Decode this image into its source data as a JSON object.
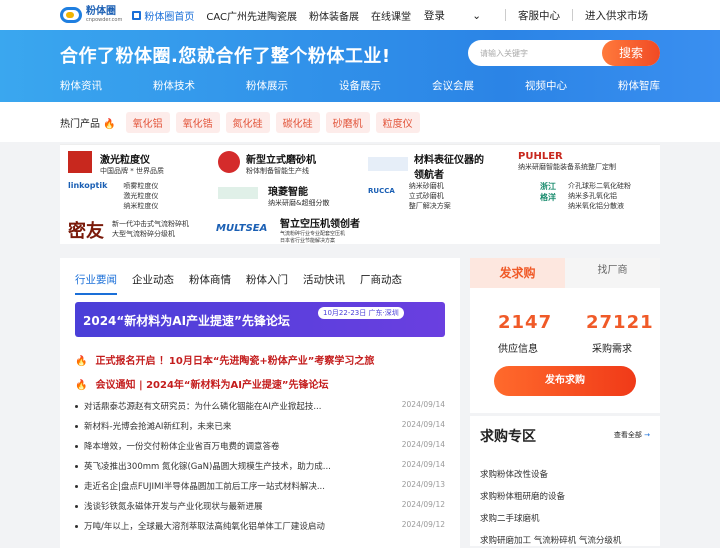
{
  "logo": {
    "name": "粉体圈",
    "sub": "cnpowder.com"
  },
  "nav1": [
    "粉体圈首页",
    "CAC广州先进陶瓷展",
    "粉体装备展",
    "在线课堂"
  ],
  "topright": {
    "login": "登录",
    "service": "客服中心",
    "market": "进入供求市场"
  },
  "slogan": "合作了粉体圈.您就合作了整个粉体工业!",
  "search": {
    "placeholder": "请输入关键字",
    "button": "搜索"
  },
  "nav2": [
    "粉体资讯",
    "粉体技术",
    "粉体展示",
    "设备展示",
    "会议会展",
    "视频中心",
    "粉体智库"
  ],
  "hot": {
    "label": "热门产品",
    "tags": [
      "氧化铝",
      "氧化锆",
      "氮化硅",
      "碳化硅",
      "砂磨机",
      "粒度仪"
    ]
  },
  "brands": [
    {
      "title": "激光粒度仪",
      "lines": [
        "中国品牌 * 世界品质"
      ]
    },
    {
      "title": "新型立式磨砂机",
      "lines": [
        "粉体制备智能生产线"
      ]
    },
    {
      "title": "材料表征仪器的",
      "lines": [
        "领航者"
      ]
    },
    {
      "title": "PUHLER",
      "lines": [
        "纳米研磨智能装备系统整厂定制"
      ]
    },
    {
      "title": "linkoptik",
      "lines": [
        "喷雾粒度仪",
        "激光粒度仪",
        "纳米粒度仪"
      ]
    },
    {
      "title": "琅菱智能",
      "lines": [
        "纳米研磨&超细分散"
      ]
    },
    {
      "title": "RUCCA",
      "lines": [
        "纳米砂磨机",
        "立式砂磨机",
        "整厂解决方案"
      ]
    },
    {
      "title": "浙江格洋",
      "lines": [
        "介孔球形二氧化硅粉",
        "纳米多孔氧化铝",
        "纳米氧化铝分散液"
      ]
    },
    {
      "title": "密友",
      "lines": [
        "新一代冲击式气流粉碎机",
        "大型气流粉碎分级机"
      ]
    },
    {
      "title": "MULTSEA",
      "lines": []
    },
    {
      "title": "智立空压机领创者",
      "lines": [
        "气流粉碎行业专业配套空压机",
        "日本省行业节能解决方案"
      ]
    }
  ],
  "tabs": [
    "行业要闻",
    "企业动态",
    "粉体商情",
    "粉体入门",
    "活动快讯",
    "厂商动态"
  ],
  "banner": {
    "text": "2024“新材料为AI产业提速”先锋论坛",
    "date": "10月22-23日 广东·深圳"
  },
  "headlines": [
    {
      "tag": "正式报名开启",
      "text": "！10月日本“先进陶瓷+粉体产业”考察学习之旅"
    },
    {
      "tag": "会议通知",
      "text": "| 2024年“新材料为AI产业提速”先锋论坛"
    }
  ],
  "news": [
    {
      "t": "对话鼎泰芯源赵有文研究员：为什么磷化铟能在AI产业掀起技...",
      "d": "2024/09/14"
    },
    {
      "t": "新材料-光博会抢滩AI新红利，未来已来",
      "d": "2024/09/14"
    },
    {
      "t": "降本增效，一份交付粉体企业省百万电费的调意答卷",
      "d": "2024/09/14"
    },
    {
      "t": "英飞凌推出300mm 氮化镓(GaN)晶圆大规模生产技术，助力成...",
      "d": "2024/09/14"
    },
    {
      "t": "走近名企|盘点FUJIMI半导体晶圆加工前后工序一站式材料解决...",
      "d": "2024/09/13"
    },
    {
      "t": "浅谈钐铁氮永磁体开发与产业化现状与最新进展",
      "d": "2024/09/12"
    },
    {
      "t": "万吨/年以上，全球最大溶剂萃取法高纯氧化铝单体工厂建设启动",
      "d": "2024/09/12"
    }
  ],
  "side": {
    "tab1": "发求购",
    "tab2": "找厂商",
    "supply": "2147",
    "supply_label": "供应信息",
    "demand": "27121",
    "demand_label": "采购需求",
    "button": "发布求购"
  },
  "buy": {
    "title": "求购专区",
    "more": "查看全部",
    "items": [
      "求购粉体改性设备",
      "求购粉体粗研磨的设备",
      "求购二手球磨机",
      "求购研磨加工 气流粉碎机 气流分级机"
    ]
  }
}
